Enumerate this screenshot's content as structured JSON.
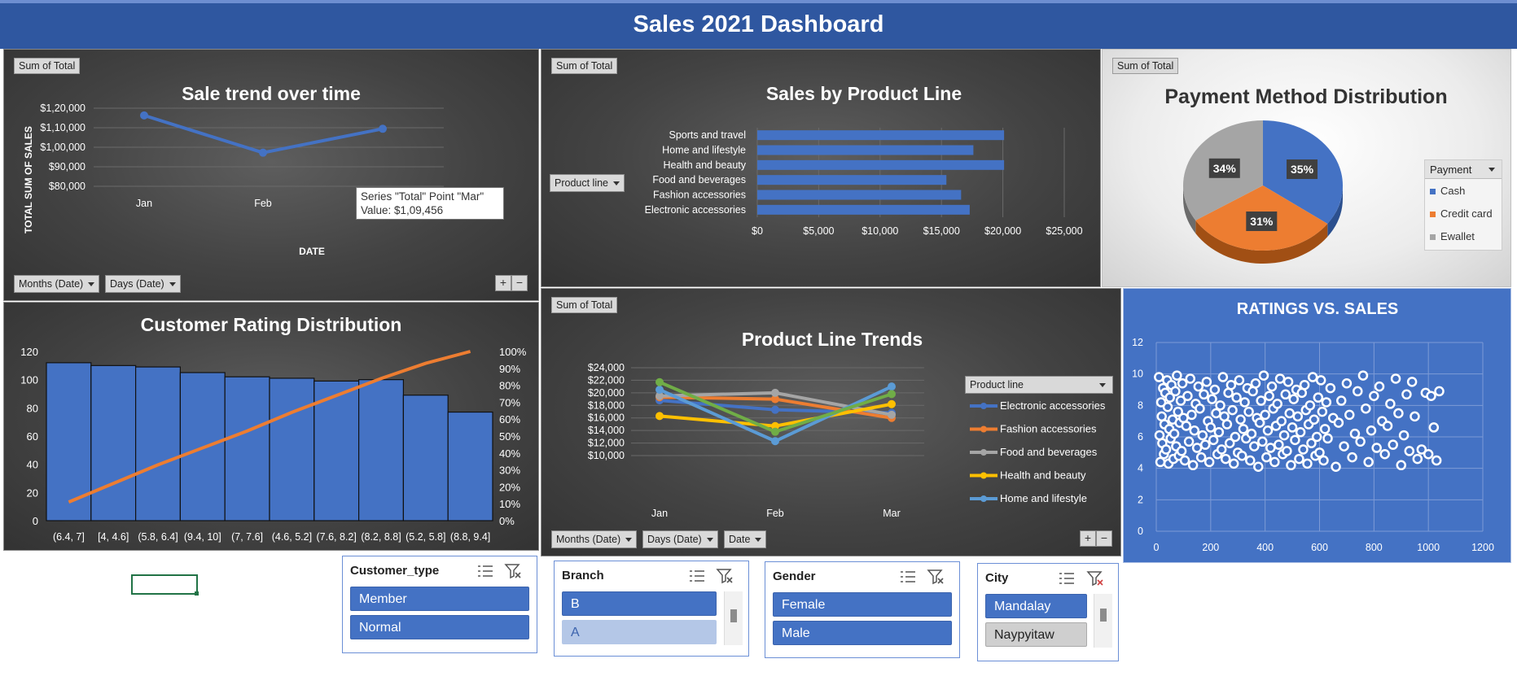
{
  "dashboard": {
    "title": "Sales 2021 Dashboard"
  },
  "colors": {
    "blue": "#4472c4",
    "orange": "#ed7d31",
    "gray": "#a5a5a5",
    "yellow": "#ffc000",
    "lightblue": "#5b9bd5",
    "green": "#70ad47",
    "header": "#2f57a0"
  },
  "common": {
    "sum_tag": "Sum of Total"
  },
  "sale_trend": {
    "title": "Sale trend over time",
    "ylabel": "TOTAL SUM OF SALES",
    "xlabel": "DATE",
    "filter_months": "Months (Date)",
    "filter_days": "Days (Date)",
    "tooltip_series": "Series \"Total\" Point \"Mar\"",
    "tooltip_value": "Value: $1,09,456",
    "plus": "+",
    "minus": "−"
  },
  "product_line": {
    "title": "Sales by Product Line",
    "filter": "Product line"
  },
  "payment": {
    "title": "Payment Method Distribution",
    "legend_title": "Payment"
  },
  "rating_dist": {
    "title": "Customer Rating Distribution"
  },
  "trends": {
    "title": "Product Line Trends",
    "legend_title": "Product line",
    "filter_months": "Months (Date)",
    "filter_days": "Days (Date)",
    "filter_date": "Date",
    "plus": "+",
    "minus": "−"
  },
  "ratings_sales": {
    "title": "RATINGS VS. SALES"
  },
  "slicers": {
    "customer_type": {
      "title": "Customer_type",
      "items": [
        "Member",
        "Normal"
      ]
    },
    "branch": {
      "title": "Branch",
      "items": [
        "B",
        "A"
      ]
    },
    "gender": {
      "title": "Gender",
      "items": [
        "Female",
        "Male"
      ]
    },
    "city": {
      "title": "City",
      "items": [
        "Mandalay",
        "Naypyitaw"
      ]
    }
  },
  "chart_data": [
    {
      "id": "sale_trend",
      "type": "line",
      "title": "Sale trend over time",
      "xlabel": "DATE",
      "ylabel": "TOTAL SUM OF SALES",
      "categories": [
        "Jan",
        "Feb",
        "Mar"
      ],
      "series": [
        {
          "name": "Total",
          "values": [
            116292,
            97219,
            109456
          ]
        }
      ],
      "ylim": [
        80000,
        120000
      ],
      "yticks": [
        "$80,000",
        "$90,000",
        "$1,00,000",
        "$1,10,000",
        "$1,20,000"
      ],
      "ytick_values": [
        80000,
        90000,
        100000,
        110000,
        120000
      ]
    },
    {
      "id": "product_line",
      "type": "bar",
      "title": "Sales by Product Line",
      "categories": [
        "Sports and travel",
        "Home and lifestyle",
        "Health and beauty",
        "Food and beverages",
        "Fashion accessories",
        "Electronic accessories"
      ],
      "values": [
        20100,
        17600,
        20100,
        15400,
        16600,
        17300
      ],
      "xlim": [
        0,
        25000
      ],
      "xticks": [
        "$0",
        "$5,000",
        "$10,000",
        "$15,000",
        "$20,000",
        "$25,000"
      ],
      "xtick_values": [
        0,
        5000,
        10000,
        15000,
        20000,
        25000
      ]
    },
    {
      "id": "payment",
      "type": "pie",
      "title": "Payment Method Distribution",
      "labels": [
        "Cash",
        "Credit card",
        "Ewallet"
      ],
      "values": [
        35,
        31,
        34
      ],
      "value_labels": [
        "35%",
        "31%",
        "34%"
      ]
    },
    {
      "id": "rating_dist",
      "type": "bar",
      "title": "Customer Rating Distribution",
      "categories": [
        "(6.4, 7]",
        "[4, 4.6]",
        "(5.8, 6.4]",
        "(9.4, 10]",
        "(7, 7.6]",
        "(4.6, 5.2]",
        "(7.6, 8.2]",
        "(8.2, 8.8]",
        "(5.2, 5.8]",
        "(8.8, 9.4]"
      ],
      "values": [
        112,
        110,
        109,
        105,
        102,
        101,
        99,
        100,
        89,
        77
      ],
      "cumulative_percent": [
        11,
        22,
        33,
        43,
        53,
        64,
        74,
        84,
        93,
        100
      ],
      "ylim": [
        0,
        120
      ],
      "yticks": [
        "0",
        "20",
        "40",
        "60",
        "80",
        "100",
        "120"
      ],
      "ytick_values": [
        0,
        20,
        40,
        60,
        80,
        100,
        120
      ],
      "y2ticks": [
        "0%",
        "10%",
        "20%",
        "30%",
        "40%",
        "50%",
        "60%",
        "70%",
        "80%",
        "90%",
        "100%"
      ]
    },
    {
      "id": "trends",
      "type": "line",
      "title": "Product Line Trends",
      "categories": [
        "Jan",
        "Feb",
        "Mar"
      ],
      "series": [
        {
          "name": "Electronic accessories",
          "values": [
            18800,
            17300,
            16800
          ]
        },
        {
          "name": "Fashion accessories",
          "values": [
            19300,
            19000,
            16000
          ]
        },
        {
          "name": "Food and beverages",
          "values": [
            19500,
            20000,
            16500
          ]
        },
        {
          "name": "Health and beauty",
          "values": [
            16300,
            14700,
            18200
          ]
        },
        {
          "name": "Home and lifestyle",
          "values": [
            20500,
            12300,
            21000
          ]
        },
        {
          "values": [
            21700,
            13800,
            19800
          ]
        }
      ],
      "ylim": [
        10000,
        24000
      ],
      "yticks": [
        "$10,000",
        "$12,000",
        "$14,000",
        "$16,000",
        "$18,000",
        "$20,000",
        "$22,000",
        "$24,000"
      ],
      "ytick_values": [
        10000,
        12000,
        14000,
        16000,
        18000,
        20000,
        22000,
        24000
      ]
    },
    {
      "id": "ratings_sales",
      "type": "scatter",
      "title": "RATINGS VS. SALES",
      "xlim": [
        0,
        1200
      ],
      "ylim": [
        0,
        12
      ],
      "xticks": [
        "0",
        "200",
        "400",
        "600",
        "800",
        "1000",
        "1200"
      ],
      "xtick_values": [
        0,
        200,
        400,
        600,
        800,
        1000,
        1200
      ],
      "yticks": [
        "0",
        "2",
        "4",
        "6",
        "8",
        "10",
        "12"
      ],
      "ytick_values": [
        0,
        2,
        4,
        6,
        8,
        10,
        12
      ],
      "points": [
        [
          10,
          9.8
        ],
        [
          12,
          6.1
        ],
        [
          15,
          4.4
        ],
        [
          18,
          8.2
        ],
        [
          20,
          7.3
        ],
        [
          22,
          5.6
        ],
        [
          25,
          9.1
        ],
        [
          28,
          4.9
        ],
        [
          30,
          6.8
        ],
        [
          33,
          8.8
        ],
        [
          36,
          5.2
        ],
        [
          40,
          9.6
        ],
        [
          42,
          7.9
        ],
        [
          45,
          4.3
        ],
        [
          48,
          6.5
        ],
        [
          50,
          8.5
        ],
        [
          53,
          5.9
        ],
        [
          56,
          9.3
        ],
        [
          60,
          7.1
        ],
        [
          63,
          4.6
        ],
        [
          66,
          6.2
        ],
        [
          70,
          8.9
        ],
        [
          73,
          5.4
        ],
        [
          76,
          9.9
        ],
        [
          80,
          7.6
        ],
        [
          83,
          4.8
        ],
        [
          86,
          6.9
        ],
        [
          90,
          8.3
        ],
        [
          93,
          5.1
        ],
        [
          96,
          9.4
        ],
        [
          100,
          7.2
        ],
        [
          105,
          4.5
        ],
        [
          110,
          6.7
        ],
        [
          115,
          8.6
        ],
        [
          120,
          5.7
        ],
        [
          125,
          9.7
        ],
        [
          130,
          7.4
        ],
        [
          135,
          4.2
        ],
        [
          140,
          6.4
        ],
        [
          145,
          8.1
        ],
        [
          150,
          5.3
        ],
        [
          155,
          9.2
        ],
        [
          160,
          7.8
        ],
        [
          165,
          4.7
        ],
        [
          170,
          6.1
        ],
        [
          175,
          8.7
        ],
        [
          180,
          5.5
        ],
        [
          185,
          9.5
        ],
        [
          190,
          7.0
        ],
        [
          195,
          4.4
        ],
        [
          200,
          6.6
        ],
        [
          205,
          8.4
        ],
        [
          210,
          5.8
        ],
        [
          215,
          9.0
        ],
        [
          220,
          7.5
        ],
        [
          225,
          4.9
        ],
        [
          230,
          6.3
        ],
        [
          235,
          8.0
        ],
        [
          240,
          5.2
        ],
        [
          245,
          9.8
        ],
        [
          250,
          7.3
        ],
        [
          255,
          4.6
        ],
        [
          260,
          6.8
        ],
        [
          265,
          8.8
        ],
        [
          270,
          5.6
        ],
        [
          275,
          9.3
        ],
        [
          280,
          7.7
        ],
        [
          285,
          4.3
        ],
        [
          290,
          6.0
        ],
        [
          295,
          8.5
        ],
        [
          300,
          5.0
        ],
        [
          305,
          9.6
        ],
        [
          310,
          7.1
        ],
        [
          315,
          4.8
        ],
        [
          320,
          6.5
        ],
        [
          325,
          8.2
        ],
        [
          330,
          5.9
        ],
        [
          335,
          9.1
        ],
        [
          340,
          7.6
        ],
        [
          345,
          4.5
        ],
        [
          350,
          6.2
        ],
        [
          355,
          8.9
        ],
        [
          360,
          5.4
        ],
        [
          365,
          9.4
        ],
        [
          370,
          7.2
        ],
        [
          375,
          4.1
        ],
        [
          380,
          6.9
        ],
        [
          385,
          8.3
        ],
        [
          390,
          5.7
        ],
        [
          395,
          9.9
        ],
        [
          400,
          7.4
        ],
        [
          405,
          4.7
        ],
        [
          410,
          6.4
        ],
        [
          415,
          8.6
        ],
        [
          420,
          5.3
        ],
        [
          425,
          9.2
        ],
        [
          430,
          7.8
        ],
        [
          435,
          4.4
        ],
        [
          440,
          6.7
        ],
        [
          445,
          8.1
        ],
        [
          450,
          5.5
        ],
        [
          455,
          9.7
        ],
        [
          460,
          7.0
        ],
        [
          465,
          4.9
        ],
        [
          470,
          6.1
        ],
        [
          475,
          8.7
        ],
        [
          480,
          5.1
        ],
        [
          485,
          9.5
        ],
        [
          490,
          7.5
        ],
        [
          495,
          4.2
        ],
        [
          500,
          6.6
        ],
        [
          505,
          8.4
        ],
        [
          510,
          5.8
        ],
        [
          515,
          9.0
        ],
        [
          520,
          7.3
        ],
        [
          525,
          4.6
        ],
        [
          530,
          6.3
        ],
        [
          535,
          8.8
        ],
        [
          540,
          5.2
        ],
        [
          545,
          9.3
        ],
        [
          550,
          7.7
        ],
        [
          555,
          4.3
        ],
        [
          560,
          6.8
        ],
        [
          565,
          8.0
        ],
        [
          570,
          5.6
        ],
        [
          575,
          9.8
        ],
        [
          580,
          7.1
        ],
        [
          585,
          4.8
        ],
        [
          590,
          6.0
        ],
        [
          595,
          8.5
        ],
        [
          600,
          5.0
        ],
        [
          605,
          9.6
        ],
        [
          610,
          7.6
        ],
        [
          615,
          4.5
        ],
        [
          620,
          6.5
        ],
        [
          625,
          8.2
        ],
        [
          630,
          5.9
        ],
        [
          640,
          9.1
        ],
        [
          650,
          7.2
        ],
        [
          660,
          4.1
        ],
        [
          670,
          6.9
        ],
        [
          680,
          8.3
        ],
        [
          690,
          5.4
        ],
        [
          700,
          9.4
        ],
        [
          710,
          7.4
        ],
        [
          720,
          4.7
        ],
        [
          730,
          6.2
        ],
        [
          740,
          8.9
        ],
        [
          750,
          5.7
        ],
        [
          760,
          9.9
        ],
        [
          770,
          7.8
        ],
        [
          780,
          4.4
        ],
        [
          790,
          6.4
        ],
        [
          800,
          8.6
        ],
        [
          810,
          5.3
        ],
        [
          820,
          9.2
        ],
        [
          830,
          7.0
        ],
        [
          840,
          4.9
        ],
        [
          850,
          6.7
        ],
        [
          860,
          8.1
        ],
        [
          870,
          5.5
        ],
        [
          880,
          9.7
        ],
        [
          890,
          7.5
        ],
        [
          900,
          4.2
        ],
        [
          910,
          6.1
        ],
        [
          920,
          8.7
        ],
        [
          930,
          5.1
        ],
        [
          940,
          9.5
        ],
        [
          950,
          7.3
        ],
        [
          960,
          4.6
        ],
        [
          975,
          5.2
        ],
        [
          990,
          8.8
        ],
        [
          1000,
          4.9
        ],
        [
          1010,
          8.6
        ],
        [
          1020,
          6.6
        ],
        [
          1030,
          4.5
        ],
        [
          1040,
          8.9
        ]
      ]
    }
  ]
}
